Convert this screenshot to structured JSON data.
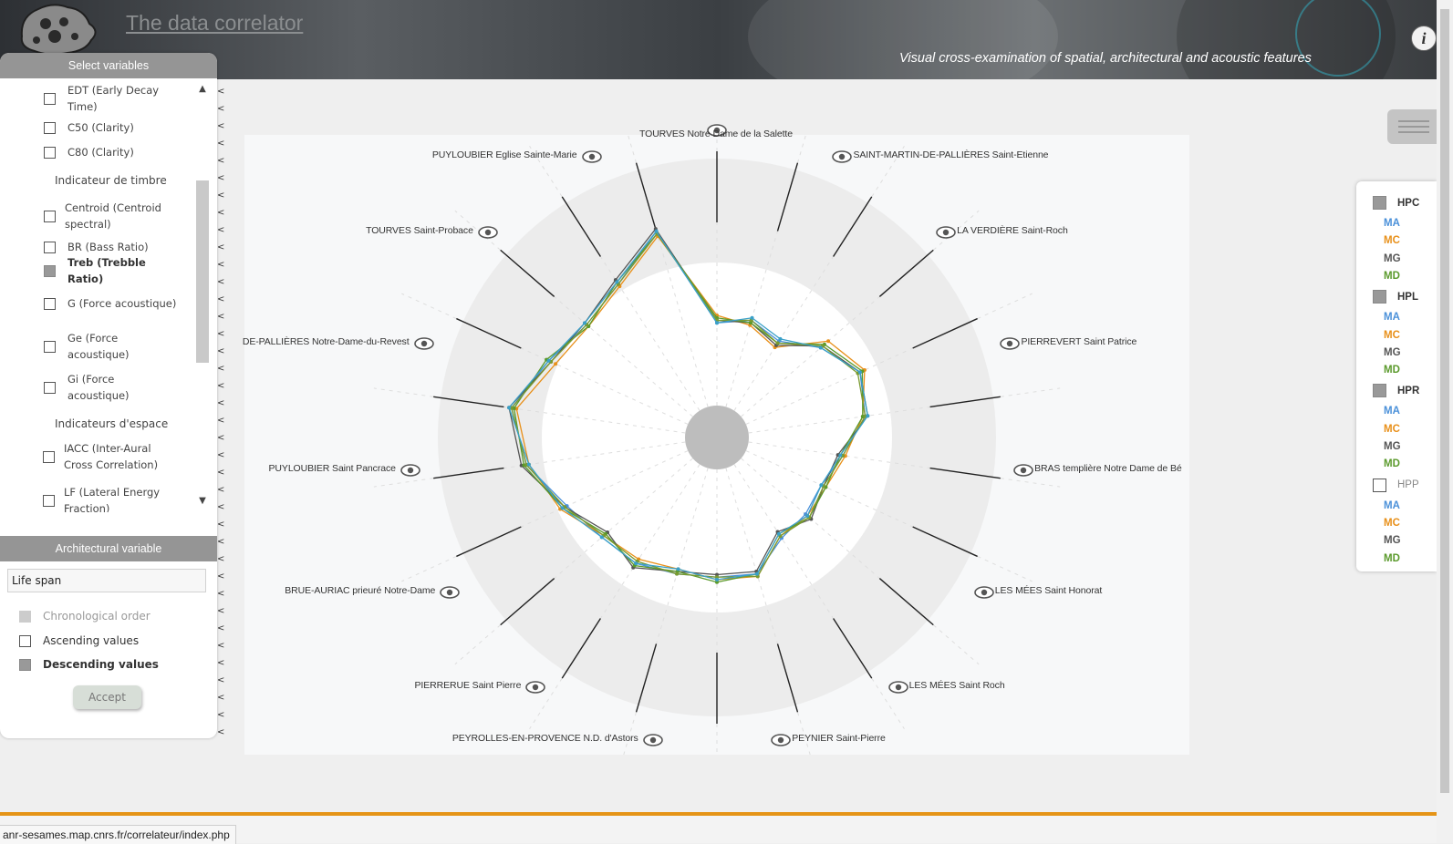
{
  "header": {
    "title": "The data correlator",
    "subtitle": "Visual cross-examination of spatial, architectural and acoustic features"
  },
  "left_panel": {
    "title": "Select variables",
    "items": [
      {
        "type": "var",
        "label": "EDT (Early Decay Time)",
        "checked": false
      },
      {
        "type": "var",
        "label": "C50 (Clarity)",
        "checked": false
      },
      {
        "type": "var",
        "label": "C80 (Clarity)",
        "checked": false
      },
      {
        "type": "group",
        "label": "Indicateur de timbre"
      },
      {
        "type": "var",
        "label": "Centroid (Centroid spectral)",
        "checked": false
      },
      {
        "type": "var",
        "label": "BR (Bass Ratio)",
        "checked": false
      },
      {
        "type": "var",
        "label": "Treb (Trebble Ratio)",
        "checked": true
      },
      {
        "type": "var",
        "label": "G (Force acoustique)",
        "checked": false
      },
      {
        "type": "var",
        "label": "Ge (Force acoustique)",
        "checked": false
      },
      {
        "type": "var",
        "label": "Gi (Force acoustique)",
        "checked": false
      },
      {
        "type": "group",
        "label": "Indicateurs d'espace"
      },
      {
        "type": "var",
        "label": "IACC (Inter-Aural Cross Correlation)",
        "checked": false
      },
      {
        "type": "var",
        "label": "LF (Lateral Energy Fraction)",
        "checked": false
      }
    ]
  },
  "architectural": {
    "title": "Architectural variable",
    "selected": "Life span",
    "sort_options": [
      {
        "label": "Chronological order",
        "state": "disabled"
      },
      {
        "label": "Ascending values",
        "state": "unchecked"
      },
      {
        "label": "Descending values",
        "state": "checked"
      }
    ],
    "accept_label": "Accept"
  },
  "chart_data": {
    "type": "radar",
    "axes": [
      "TOURVES Notre Dame de la Salette",
      "SAINT-MARTIN-DE-PALLIÈRES Saint-Etienne",
      "LA VERDIÈRE Saint-Roch",
      "PIERREVERT Saint Patrice",
      "BRAS templière Notre Dame de Bé",
      "LES MÉES Saint Honorat",
      "LES MÉES Saint Roch",
      "PEYNIER Saint-Pierre",
      "PEYROLLES-EN-PROVENCE N.D. d'Astors",
      "PIERRERUE Saint Pierre",
      "BRUE-AURIAC prieuré Notre-Dame",
      "PUYLOUBIER Saint Pancrace",
      "DE-PALLIÈRES Notre-Dame-du-Revest",
      "TOURVES Saint-Probace",
      "PUYLOUBIER Eglise Sainte-Marie"
    ],
    "series": [
      {
        "name": "HPC MA",
        "color": "#4a90d9",
        "values": [
          0.33,
          0.36,
          0.33,
          0.42,
          0.5,
          0.47,
          0.38,
          0.33,
          0.34,
          0.35,
          0.44,
          0.43,
          0.44,
          0.47,
          0.48,
          0.53,
          0.64,
          0.7,
          0.61,
          0.56,
          0.6,
          0.73
        ]
      },
      {
        "name": "HPC MC",
        "color": "#e8901a",
        "values": [
          0.36,
          0.34,
          0.3,
          0.46,
          0.52,
          0.46,
          0.39,
          0.35,
          0.35,
          0.34,
          0.45,
          0.44,
          0.42,
          0.45,
          0.47,
          0.56,
          0.63,
          0.68,
          0.58,
          0.55,
          0.59,
          0.71
        ]
      },
      {
        "name": "HPC MG",
        "color": "#555555",
        "values": [
          0.34,
          0.35,
          0.31,
          0.43,
          0.5,
          0.48,
          0.36,
          0.34,
          0.37,
          0.32,
          0.43,
          0.42,
          0.43,
          0.49,
          0.45,
          0.54,
          0.66,
          0.71,
          0.6,
          0.57,
          0.62,
          0.74
        ]
      },
      {
        "name": "HPC MD",
        "color": "#5b9a2c",
        "values": [
          0.35,
          0.35,
          0.32,
          0.44,
          0.51,
          0.46,
          0.37,
          0.35,
          0.36,
          0.33,
          0.44,
          0.45,
          0.43,
          0.48,
          0.46,
          0.55,
          0.65,
          0.69,
          0.62,
          0.55,
          0.61,
          0.72
        ]
      },
      {
        "name": "HPL MD",
        "color": "#7a9a30",
        "values": [
          0.34,
          0.36,
          0.32,
          0.43,
          0.49,
          0.47,
          0.38,
          0.34,
          0.36,
          0.34,
          0.45,
          0.43,
          0.44,
          0.46,
          0.47,
          0.54,
          0.64,
          0.7,
          0.6,
          0.56,
          0.6,
          0.72
        ]
      },
      {
        "name": "HPR MA",
        "color": "#3aa0c8",
        "values": [
          0.33,
          0.37,
          0.34,
          0.42,
          0.5,
          0.48,
          0.37,
          0.33,
          0.35,
          0.33,
          0.44,
          0.44,
          0.42,
          0.47,
          0.48,
          0.55,
          0.63,
          0.71,
          0.61,
          0.57,
          0.61,
          0.73
        ]
      }
    ]
  },
  "legend": {
    "groups": [
      {
        "label": "HPC",
        "checked": true,
        "items": [
          "MA",
          "MC",
          "MG",
          "MD"
        ]
      },
      {
        "label": "HPL",
        "checked": true,
        "items": [
          "MA",
          "MC",
          "MG",
          "MD"
        ]
      },
      {
        "label": "HPR",
        "checked": true,
        "items": [
          "MA",
          "MC",
          "MG",
          "MD"
        ]
      },
      {
        "label": "HPP",
        "checked": false,
        "items": [
          "MA",
          "MC",
          "MG",
          "MD"
        ]
      }
    ],
    "item_colors": {
      "MA": "#4a90d9",
      "MC": "#e8901a",
      "MG": "#555555",
      "MD": "#5b9a2c"
    }
  },
  "status_bar": {
    "url": "anr-sesames.map.cnrs.fr/correlateur/index.php"
  },
  "colors": {
    "accent_orange": "#e59416",
    "panel_header": "#959595"
  }
}
